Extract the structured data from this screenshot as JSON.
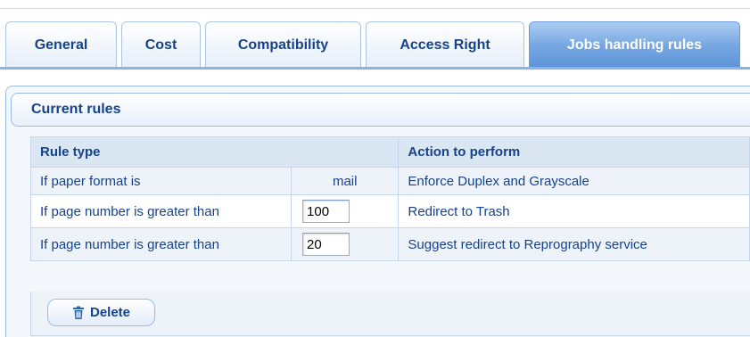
{
  "tabs": [
    {
      "label": "General",
      "active": false
    },
    {
      "label": "Cost",
      "active": false
    },
    {
      "label": "Compatibility",
      "active": false
    },
    {
      "label": "Access Right",
      "active": false
    },
    {
      "label": "Jobs handling rules",
      "active": true
    }
  ],
  "panel": {
    "title": "Current rules"
  },
  "table": {
    "headers": {
      "rule_type": "Rule type",
      "action": "Action to perform"
    },
    "rows": [
      {
        "rule_type": "If paper format is",
        "param": "mail",
        "param_editable": false,
        "action": "Enforce Duplex and Grayscale"
      },
      {
        "rule_type": "If page number is greater than",
        "param": "100",
        "param_editable": true,
        "action": "Redirect to Trash"
      },
      {
        "rule_type": "If page number is greater than",
        "param": "20",
        "param_editable": true,
        "action": "Suggest redirect to Reprography service"
      }
    ]
  },
  "footer": {
    "delete_label": "Delete",
    "delete_icon": "trash-icon"
  },
  "colors": {
    "accent": "#15428b",
    "active_tab": "#5c93d8",
    "border": "#99bbe8"
  }
}
